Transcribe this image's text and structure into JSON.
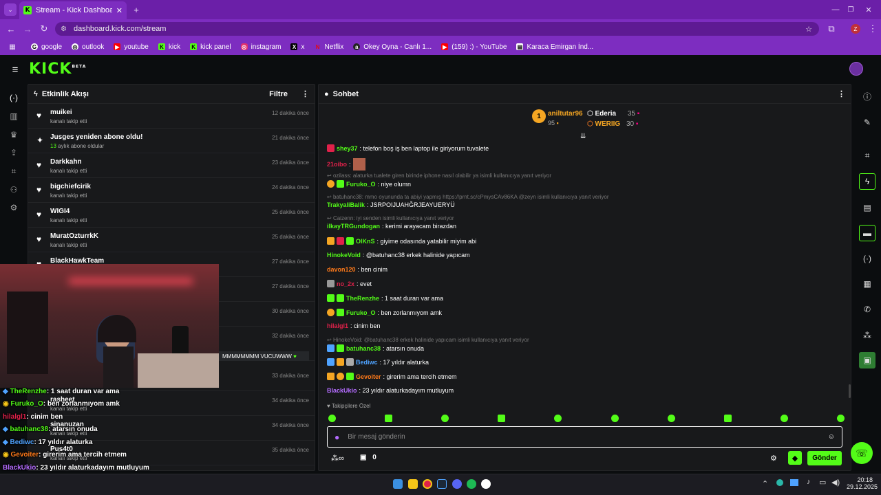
{
  "browser": {
    "tab_title": "Stream - Kick Dashboard",
    "url": "dashboard.kick.com/stream",
    "profile_initial": "Z",
    "bookmarks": [
      {
        "label": "google",
        "color": "#ffffff"
      },
      {
        "label": "outlook",
        "color": "#ffffff"
      },
      {
        "label": "youtube",
        "color": "#ff0000"
      },
      {
        "label": "kick",
        "color": "#53fc18"
      },
      {
        "label": "kick panel",
        "color": "#53fc18"
      },
      {
        "label": "instagram",
        "color": "#e1306c"
      },
      {
        "label": "x",
        "color": "#ffffff"
      },
      {
        "label": "Netflix",
        "color": "#e50914"
      },
      {
        "label": "Okey Oyna - Canlı 1...",
        "color": "#ffffff"
      },
      {
        "label": "(159) :) - YouTube",
        "color": "#ff0000"
      },
      {
        "label": "Karaca Emirgan İnd...",
        "color": "#ffffff"
      }
    ]
  },
  "brand": {
    "logo": "KICK",
    "beta": "BETA",
    "accent": "#53fc18"
  },
  "activity": {
    "title": "Etkinlik Akışı",
    "filter_label": "Filtre",
    "items": [
      {
        "name": "muikei",
        "sub": "kanalı takip etti",
        "time": "12 dakika önce",
        "icon": "heart-icon"
      },
      {
        "name": "Jusges yeniden abone oldu!",
        "sub_num": "13",
        "sub": "aylık abone oldular",
        "time": "21 dakika önce",
        "icon": "sparkle-icon"
      },
      {
        "name": "Darkkahn",
        "sub": "kanalı takip etti",
        "time": "23 dakika önce",
        "icon": "heart-icon"
      },
      {
        "name": "bigchiefcirik",
        "sub": "kanalı takip etti",
        "time": "24 dakika önce",
        "icon": "heart-icon"
      },
      {
        "name": "WIGI4",
        "sub": "kanalı takip etti",
        "time": "25 dakika önce",
        "icon": "heart-icon"
      },
      {
        "name": "MuratOzturrkK",
        "sub": "kanalı takip etti",
        "time": "25 dakika önce",
        "icon": "heart-icon"
      },
      {
        "name": "BlackHawkTeam",
        "sub": "",
        "time": "27 dakika önce",
        "icon": "heart-icon"
      }
    ],
    "hidden_times": [
      "27 dakika önce",
      "30 dakika önce",
      "32 dakika önce",
      "33 dakika önce",
      "34 dakika önce",
      "34 dakika önce",
      "35 dakika önce"
    ],
    "msg_snippet": "MMMMMMMM VUCUWWW",
    "lower_items": [
      {
        "name": "rasheet",
        "sub": "kanalı takip etti"
      },
      {
        "name": "sinanuzan",
        "sub": "kanalı takip etti"
      },
      {
        "name": "Pus4t0",
        "sub": "kanalı takip etti"
      }
    ]
  },
  "chat": {
    "title": "Sohbet",
    "leaders": [
      {
        "rank": "1",
        "name": "aniltutar96",
        "value": "95"
      },
      {
        "name": "Ederia",
        "value": "35"
      },
      {
        "name": "WERIIG",
        "value": "30"
      }
    ],
    "messages": [
      {
        "user": "shey37",
        "color": "#53fc18",
        "text": ": telefon boş iş ben laptop ile giriyorum tuvalete"
      },
      {
        "user": "21oibo",
        "color": "#e0214a",
        "text": ":"
      },
      {
        "reply": "ozilass: alaturka tualete giren birinde iphone nasıl olabilir ya isimli kullanıcıya yanıt veriyor"
      },
      {
        "user": "Furuko_O",
        "color": "#53fc18",
        "text": ": niye olumn"
      },
      {
        "reply": "batuhanc38: mmo oyununda ta abiyi yapmış https://prnt.sc/cPmysCAv86KA @zeyn isimli kullanıcıya yanıt veriyor"
      },
      {
        "user": "TrakyaliBalik",
        "color": "#53fc18",
        "text": ": JSRPOIJUAHĞRJEAYUERYÜ"
      },
      {
        "reply": "Caizenn: iyi senden isimli kullanıcıya yanıt veriyor"
      },
      {
        "user": "ilkayTRGundogan",
        "color": "#53fc18",
        "text": ": kerimi arayacam birazdan"
      },
      {
        "user": "OlKnS",
        "color": "#53fc18",
        "text": ": giyime odasında yatabilir miyim abi"
      },
      {
        "user": "HinokeVoid",
        "color": "#53fc18",
        "text": ": @batuhanc38 erkek halinide yapıcam"
      },
      {
        "user": "davon120",
        "color": "#ff7a1a",
        "text": ": ben cinim"
      },
      {
        "user": "no_2x",
        "color": "#e0214a",
        "text": ": evet"
      },
      {
        "user": "TheRenzhe",
        "color": "#53fc18",
        "text": ": 1 saat duran var ama"
      },
      {
        "user": "Furuko_O",
        "color": "#53fc18",
        "text": ": ben zorlanmıyom amk"
      },
      {
        "user": "hilalgl1",
        "color": "#e0214a",
        "text": ": cinim ben"
      },
      {
        "reply": "HinokeVoid: @batuhanc38 erkek halinide yapıcam isimli kullanıcıya yanıt veriyor"
      },
      {
        "user": "batuhanc38",
        "color": "#53fc18",
        "text": ": atarsın onuda"
      },
      {
        "user": "Bediwc",
        "color": "#4fa3ff",
        "text": ": 17 yıldır alaturka"
      },
      {
        "user": "Gevoiter",
        "color": "#ff7a1a",
        "text": ": girerim ama tercih etmem"
      },
      {
        "user": "BlackUkio",
        "color": "#b46cff",
        "text": ": 23 yıldır alaturkadayım mutluyum"
      }
    ],
    "followers_only": "Takipçilere Özel",
    "input_placeholder": "Bir mesaj gönderin",
    "points": "0",
    "send_label": "Gönder"
  },
  "overlay": [
    {
      "user": "TheRenzhe",
      "color": "#53fc18",
      "text": ": 1 saat duran var ama"
    },
    {
      "user": "Furuko_O",
      "color": "#53fc18",
      "text": ": ben zorlanmıyom amk"
    },
    {
      "user": "hilalgl1",
      "color": "#e0214a",
      "text": ": cinim ben"
    },
    {
      "user": "batuhanc38",
      "color": "#53fc18",
      "text": ": atarsın onuda"
    },
    {
      "user": "Bediwc",
      "color": "#4fa3ff",
      "text": ": 17 yıldır alaturka"
    },
    {
      "user": "Gevoiter",
      "color": "#ff7a1a",
      "text": ": girerim ama tercih etmem"
    },
    {
      "user": "BlackUkio",
      "color": "#b46cff",
      "text": ": 23 yıldır alaturkadayım mutluyum"
    }
  ],
  "taskbar": {
    "time": "20:18",
    "date": "29.12.2025"
  }
}
